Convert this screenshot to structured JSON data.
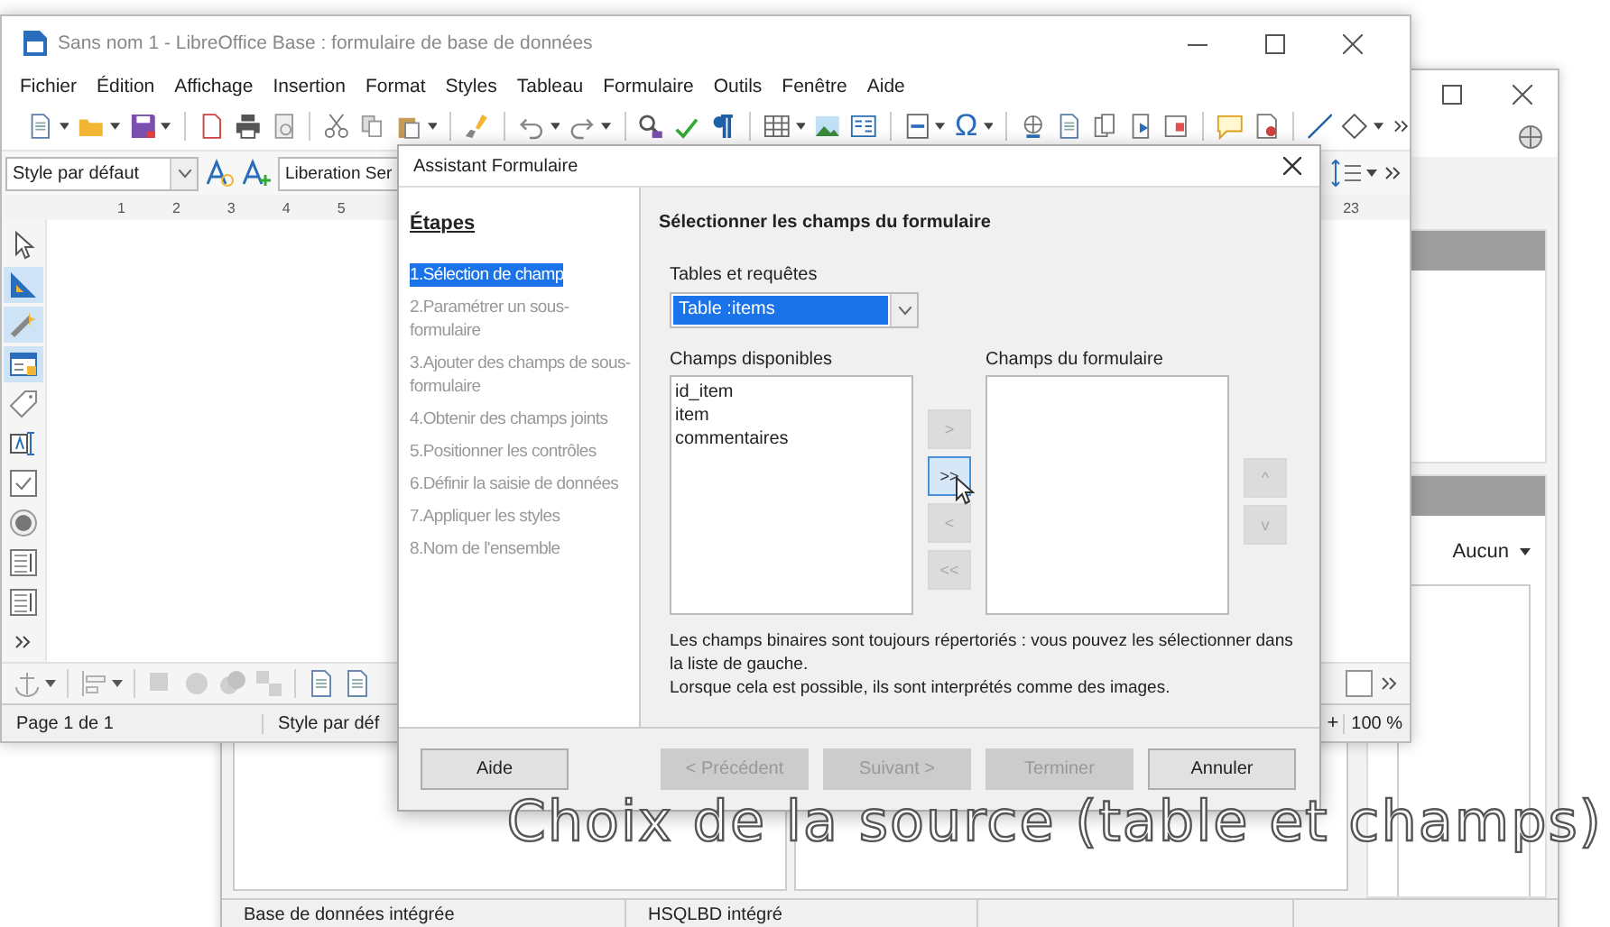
{
  "back_window": {
    "sidebar": {
      "dropdown": "Aucun"
    },
    "status_bar": [
      "Base de données intégrée",
      "HSQLBD intégré"
    ]
  },
  "writer_window": {
    "title": "Sans nom 1 - LibreOffice Base : formulaire de base de données",
    "menu": [
      "Fichier",
      "Édition",
      "Affichage",
      "Insertion",
      "Format",
      "Styles",
      "Tableau",
      "Formulaire",
      "Outils",
      "Fenêtre",
      "Aide"
    ],
    "special_character": "Ω",
    "style_box": "Style par défaut",
    "font_box": "Liberation Ser",
    "ruler_ticks": [
      "1",
      "2",
      "3",
      "4",
      "5"
    ],
    "ruler_right_tick": "23",
    "form_controls": [
      {
        "selected": false
      },
      {
        "selected": true
      },
      {
        "selected": true
      },
      {
        "selected": true
      },
      {
        "selected": false
      },
      {
        "selected": false
      },
      {
        "selected": false
      },
      {
        "selected": false
      },
      {
        "selected": false
      },
      {
        "selected": false
      }
    ],
    "status_bar": {
      "page": "Page 1 de 1",
      "style": "Style par déf",
      "zoom_plus": "+",
      "zoom": "100 %"
    }
  },
  "dialog": {
    "title": "Assistant Formulaire",
    "steps_heading": "Étapes",
    "steps": [
      {
        "label": "1.Sélection de champ",
        "selected": true
      },
      {
        "label": "2.Paramétrer un sous-formulaire",
        "selected": false
      },
      {
        "label": "3.Ajouter des champs de sous-formulaire",
        "selected": false
      },
      {
        "label": "4.Obtenir des champs joints",
        "selected": false
      },
      {
        "label": "5.Positionner les contrôles",
        "selected": false
      },
      {
        "label": "6.Définir la saisie de données",
        "selected": false
      },
      {
        "label": "7.Appliquer les styles",
        "selected": false
      },
      {
        "label": "8.Nom de l'ensemble",
        "selected": false
      }
    ],
    "heading": "Sélectionner les champs du formulaire",
    "tables_label": "Tables et requêtes",
    "table_combo": {
      "value": "Table :items",
      "highlighted": true
    },
    "available_label": "Champs disponibles",
    "available_fields": [
      "id_item",
      "item",
      "commentaires"
    ],
    "form_fields_label": "Champs du formulaire",
    "move_buttons": [
      {
        "label": ">",
        "disabled": true,
        "hovered": false
      },
      {
        "label": ">>",
        "disabled": false,
        "hovered": true
      },
      {
        "label": "<",
        "disabled": true,
        "hovered": false
      },
      {
        "label": "<<",
        "disabled": true,
        "hovered": false
      }
    ],
    "order_buttons": [
      {
        "label": "^",
        "disabled": true
      },
      {
        "label": "v",
        "disabled": true
      }
    ],
    "note": [
      "Les champs binaires sont toujours répertoriés : vous pouvez les sélectionner dans la liste de gauche.",
      "Lorsque cela est possible, ils sont interprétés comme des images."
    ],
    "buttons": [
      {
        "label": "Aide",
        "disabled": false
      },
      {
        "label": "< Précédent",
        "disabled": true
      },
      {
        "label": "Suivant >",
        "disabled": true
      },
      {
        "label": "Terminer",
        "disabled": true
      },
      {
        "label": "Annuler",
        "disabled": false
      }
    ]
  },
  "caption": "Choix de la source (table et champs)"
}
